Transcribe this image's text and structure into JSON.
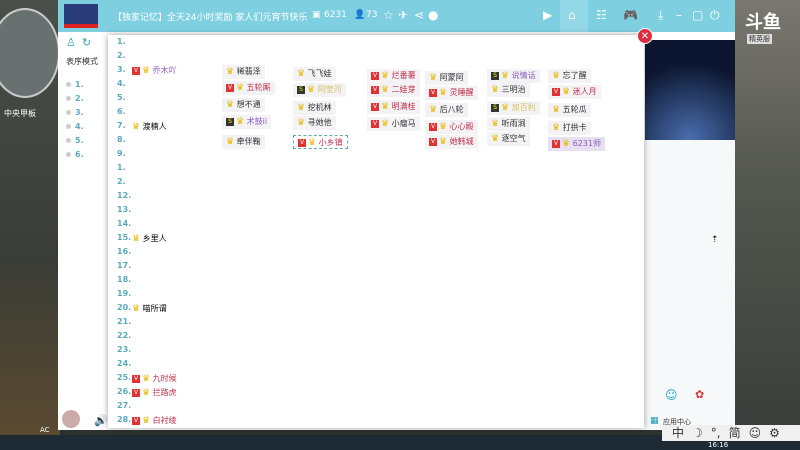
{
  "title": "【独家记忆】全天24小时奖励 家人们元宵节快乐",
  "stats": {
    "fans": "6231",
    "online": "73"
  },
  "game_overlay": {
    "map_label": "中央甲板",
    "logo": "斗鱼",
    "sub": "精英服",
    "ac": "AC"
  },
  "left_panel": {
    "mode_label": "表序模式",
    "numbers": [
      "1.",
      "2.",
      "3.",
      "4.",
      "5.",
      "6."
    ]
  },
  "popup_list": [
    {
      "n": "1.",
      "name": ""
    },
    {
      "n": "2.",
      "name": ""
    },
    {
      "n": "3.",
      "name": "乔木吖",
      "badge": "V",
      "color": "purple"
    },
    {
      "n": "4.",
      "name": ""
    },
    {
      "n": "5.",
      "name": ""
    },
    {
      "n": "6.",
      "name": ""
    },
    {
      "n": "7.",
      "name": "渡楠人"
    },
    {
      "n": "8.",
      "name": ""
    },
    {
      "n": "9.",
      "name": ""
    },
    {
      "n": "1.",
      "name": ""
    },
    {
      "n": "2.",
      "name": ""
    },
    {
      "n": "12.",
      "name": ""
    },
    {
      "n": "13.",
      "name": ""
    },
    {
      "n": "14.",
      "name": ""
    },
    {
      "n": "15.",
      "name": "乡里人"
    },
    {
      "n": "16.",
      "name": ""
    },
    {
      "n": "17.",
      "name": ""
    },
    {
      "n": "18.",
      "name": ""
    },
    {
      "n": "19.",
      "name": ""
    },
    {
      "n": "20.",
      "name": "喵所谓"
    },
    {
      "n": "21.",
      "name": ""
    },
    {
      "n": "22.",
      "name": ""
    },
    {
      "n": "23.",
      "name": ""
    },
    {
      "n": "24.",
      "name": ""
    },
    {
      "n": "25.",
      "name": "九时候",
      "badge": "V",
      "color": "red"
    },
    {
      "n": "26.",
      "name": "拦路虎",
      "badge": "V",
      "color": "red"
    },
    {
      "n": "27.",
      "name": ""
    },
    {
      "n": "28.",
      "name": "白衬绫",
      "badge": "V",
      "color": "red"
    }
  ],
  "seats": [
    {
      "name": "稀翡泽"
    },
    {
      "name": "五轮厮",
      "badge": "V",
      "color": "red"
    },
    {
      "name": "想不通"
    },
    {
      "name": "术鼓ii",
      "badge": "S",
      "color": "purple"
    },
    {
      "name": "牵伴鞠"
    },
    {
      "name": "飞飞娃"
    },
    {
      "name": "阿莹河",
      "badge": "S",
      "color": "yellow"
    },
    {
      "name": "挖机林"
    },
    {
      "name": "寻她他"
    },
    {
      "name": "小乡镇",
      "badge": "V",
      "color": "red"
    },
    {
      "name": "烂番薯",
      "badge": "V",
      "color": "red"
    },
    {
      "name": "二娃芽",
      "badge": "V",
      "color": "red"
    },
    {
      "name": "明满桂",
      "badge": "V",
      "color": "red"
    },
    {
      "name": "小瘤马",
      "badge": "V"
    },
    {
      "name": "阿蒙阿"
    },
    {
      "name": "灵睡醒",
      "badge": "V",
      "color": "red"
    },
    {
      "name": "后八轮"
    },
    {
      "name": "心心殿",
      "badge": "V",
      "color": "red"
    },
    {
      "name": "她韩城",
      "badge": "V",
      "color": "red"
    },
    {
      "name": "说情话",
      "badge": "S",
      "color": "purple"
    },
    {
      "name": "三明治"
    },
    {
      "name": "加百利",
      "badge": "S",
      "color": "yellow"
    },
    {
      "name": "听雨涧"
    },
    {
      "name": "逐空气"
    },
    {
      "name": "忘了醒"
    },
    {
      "name": "迷人月",
      "badge": "V",
      "color": "red"
    },
    {
      "name": "五轮瓜"
    },
    {
      "name": "打拱卡"
    },
    {
      "name": "6231师",
      "badge": "V",
      "color": "purple"
    }
  ],
  "right_panel": {
    "app_center": "应用中心"
  },
  "ime": {
    "lang": "中",
    "mode": "☽",
    "punct": "°,",
    "variant": "简"
  },
  "clock": "16:16"
}
